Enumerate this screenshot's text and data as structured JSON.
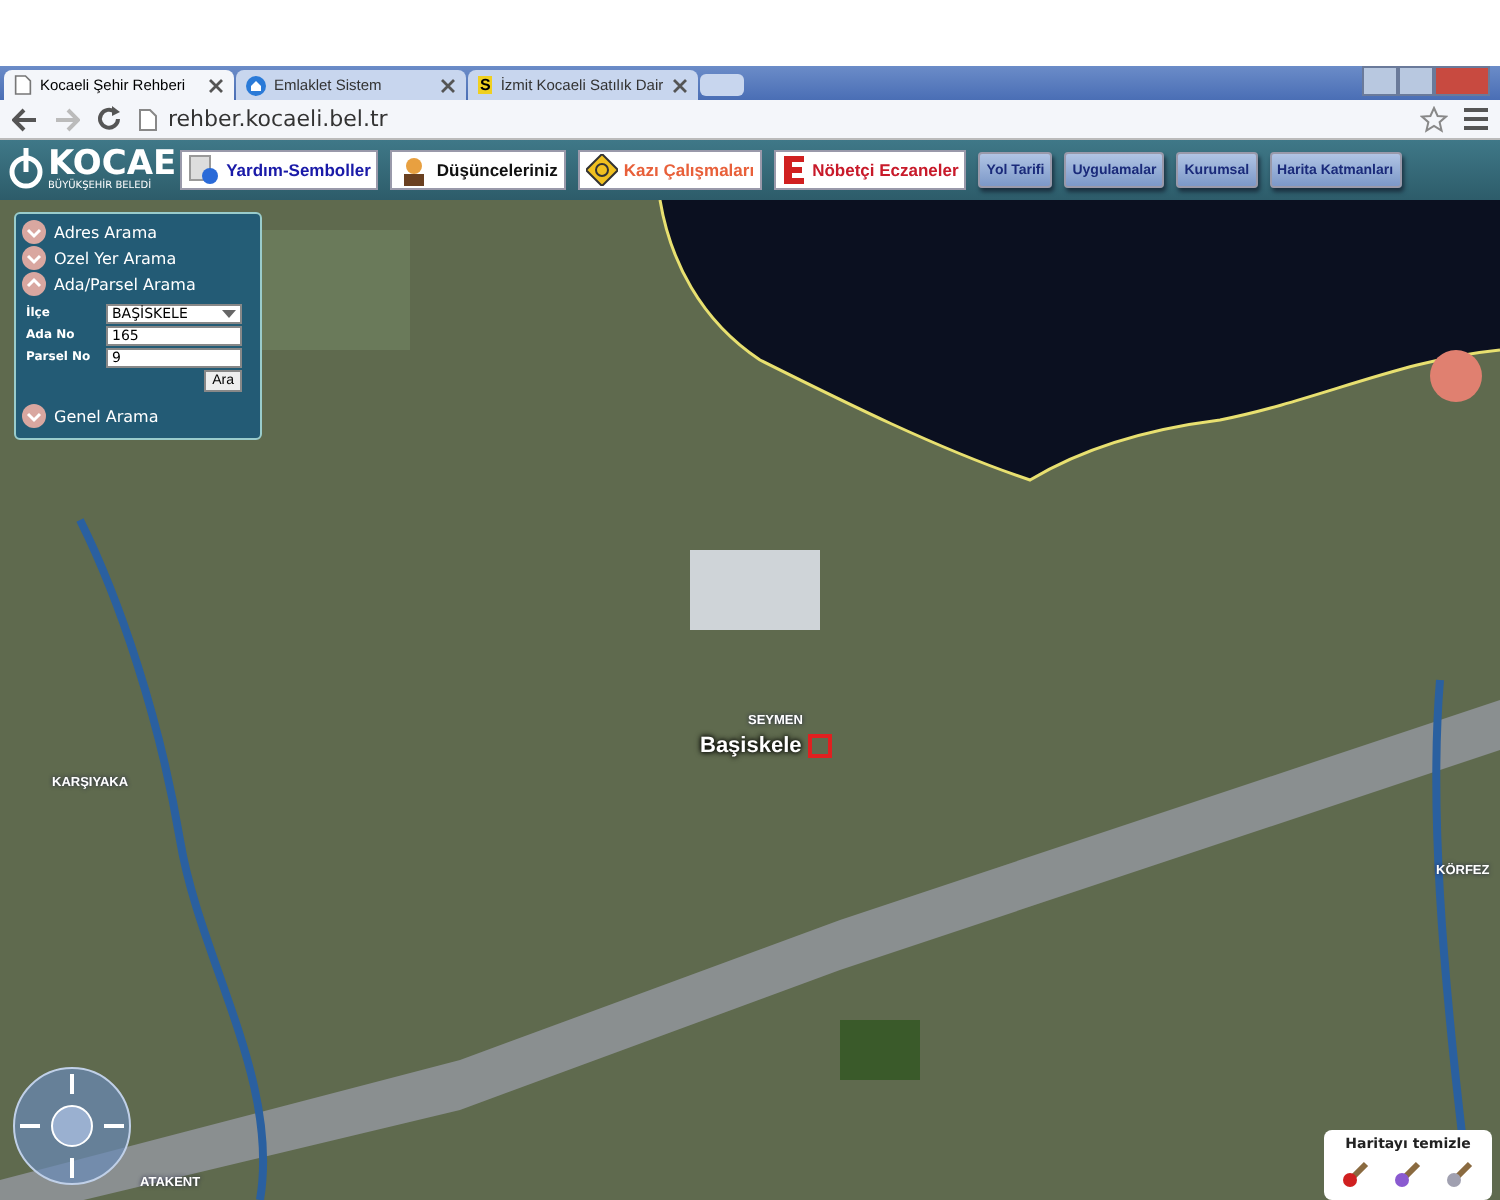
{
  "browser": {
    "tabs": [
      {
        "title": "Kocaeli Şehir Rehberi",
        "selected": true
      },
      {
        "title": "Emlaklet Sistem",
        "selected": false
      },
      {
        "title": "İzmit Kocaeli Satılık Dair",
        "selected": false,
        "icon_text": "S"
      }
    ],
    "url": "rehber.kocaeli.bel.tr"
  },
  "site": {
    "logo": {
      "title": "KOCAE",
      "subtitle": "BÜYÜKŞEHİR BELEDİ"
    },
    "nav_buttons": [
      {
        "label": "Yardım-Semboller",
        "kind": "featured",
        "color": "#1a1aa8"
      },
      {
        "label": "Düşünceleriniz",
        "kind": "featured",
        "color": "#111111"
      },
      {
        "label": "Kazı Çalışmaları",
        "kind": "featured",
        "color": "#e8603a"
      },
      {
        "label": "Nöbetçi Eczaneler",
        "kind": "featured",
        "color": "#c81a2a"
      },
      {
        "label": "Yol Tarifi",
        "kind": "plain"
      },
      {
        "label": "Uygulamalar",
        "kind": "plain"
      },
      {
        "label": "Kurumsal",
        "kind": "plain"
      },
      {
        "label": "Harita Katmanları",
        "kind": "plain"
      }
    ]
  },
  "search_panel": {
    "sections": [
      {
        "label": "Adres Arama",
        "expanded": false
      },
      {
        "label": "Ozel Yer Arama",
        "expanded": false
      },
      {
        "label": "Ada/Parsel Arama",
        "expanded": true,
        "fields": [
          {
            "label": "İlçe",
            "kind": "select",
            "value": "BAŞİSKELE"
          },
          {
            "label": "Ada No",
            "kind": "text",
            "value": "165"
          },
          {
            "label": "Parsel No",
            "kind": "text",
            "value": "9"
          }
        ],
        "button": "Ara"
      },
      {
        "label": "Genel Arama",
        "expanded": false
      }
    ]
  },
  "map_labels": [
    {
      "text": "SEYMEN",
      "kind": "neighbourhood"
    },
    {
      "text": "Başiskele",
      "kind": "district"
    },
    {
      "text": "KARŞIYAKA",
      "kind": "neighbourhood"
    },
    {
      "text": "KÖRFEZ",
      "kind": "neighbourhood"
    },
    {
      "text": "ATAKENT",
      "kind": "neighbourhood"
    }
  ],
  "clear_panel": {
    "title": "Haritayı temizle"
  }
}
